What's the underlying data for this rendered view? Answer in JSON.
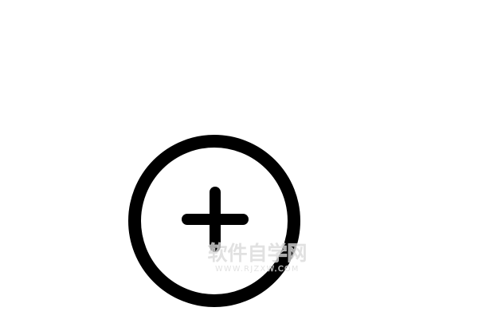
{
  "icon": {
    "name": "plus-circle-icon",
    "stroke_color": "#000000",
    "background_color": "#ffffff"
  },
  "watermark": {
    "title": "软件自学网",
    "url": "WWW.RJZXW.COM",
    "text_color": "#d9d9d9",
    "outline_color": "#ffffff"
  }
}
